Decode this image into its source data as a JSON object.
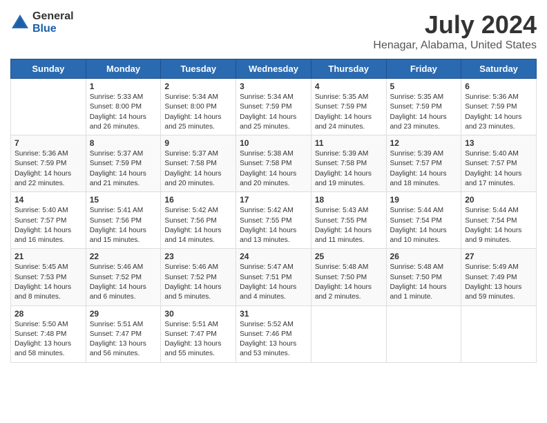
{
  "logo": {
    "general": "General",
    "blue": "Blue"
  },
  "title": "July 2024",
  "location": "Henagar, Alabama, United States",
  "headers": [
    "Sunday",
    "Monday",
    "Tuesday",
    "Wednesday",
    "Thursday",
    "Friday",
    "Saturday"
  ],
  "weeks": [
    [
      {
        "day": "",
        "sunrise": "",
        "sunset": "",
        "daylight": ""
      },
      {
        "day": "1",
        "sunrise": "Sunrise: 5:33 AM",
        "sunset": "Sunset: 8:00 PM",
        "daylight": "Daylight: 14 hours and 26 minutes."
      },
      {
        "day": "2",
        "sunrise": "Sunrise: 5:34 AM",
        "sunset": "Sunset: 8:00 PM",
        "daylight": "Daylight: 14 hours and 25 minutes."
      },
      {
        "day": "3",
        "sunrise": "Sunrise: 5:34 AM",
        "sunset": "Sunset: 7:59 PM",
        "daylight": "Daylight: 14 hours and 25 minutes."
      },
      {
        "day": "4",
        "sunrise": "Sunrise: 5:35 AM",
        "sunset": "Sunset: 7:59 PM",
        "daylight": "Daylight: 14 hours and 24 minutes."
      },
      {
        "day": "5",
        "sunrise": "Sunrise: 5:35 AM",
        "sunset": "Sunset: 7:59 PM",
        "daylight": "Daylight: 14 hours and 23 minutes."
      },
      {
        "day": "6",
        "sunrise": "Sunrise: 5:36 AM",
        "sunset": "Sunset: 7:59 PM",
        "daylight": "Daylight: 14 hours and 23 minutes."
      }
    ],
    [
      {
        "day": "7",
        "sunrise": "Sunrise: 5:36 AM",
        "sunset": "Sunset: 7:59 PM",
        "daylight": "Daylight: 14 hours and 22 minutes."
      },
      {
        "day": "8",
        "sunrise": "Sunrise: 5:37 AM",
        "sunset": "Sunset: 7:59 PM",
        "daylight": "Daylight: 14 hours and 21 minutes."
      },
      {
        "day": "9",
        "sunrise": "Sunrise: 5:37 AM",
        "sunset": "Sunset: 7:58 PM",
        "daylight": "Daylight: 14 hours and 20 minutes."
      },
      {
        "day": "10",
        "sunrise": "Sunrise: 5:38 AM",
        "sunset": "Sunset: 7:58 PM",
        "daylight": "Daylight: 14 hours and 20 minutes."
      },
      {
        "day": "11",
        "sunrise": "Sunrise: 5:39 AM",
        "sunset": "Sunset: 7:58 PM",
        "daylight": "Daylight: 14 hours and 19 minutes."
      },
      {
        "day": "12",
        "sunrise": "Sunrise: 5:39 AM",
        "sunset": "Sunset: 7:57 PM",
        "daylight": "Daylight: 14 hours and 18 minutes."
      },
      {
        "day": "13",
        "sunrise": "Sunrise: 5:40 AM",
        "sunset": "Sunset: 7:57 PM",
        "daylight": "Daylight: 14 hours and 17 minutes."
      }
    ],
    [
      {
        "day": "14",
        "sunrise": "Sunrise: 5:40 AM",
        "sunset": "Sunset: 7:57 PM",
        "daylight": "Daylight: 14 hours and 16 minutes."
      },
      {
        "day": "15",
        "sunrise": "Sunrise: 5:41 AM",
        "sunset": "Sunset: 7:56 PM",
        "daylight": "Daylight: 14 hours and 15 minutes."
      },
      {
        "day": "16",
        "sunrise": "Sunrise: 5:42 AM",
        "sunset": "Sunset: 7:56 PM",
        "daylight": "Daylight: 14 hours and 14 minutes."
      },
      {
        "day": "17",
        "sunrise": "Sunrise: 5:42 AM",
        "sunset": "Sunset: 7:55 PM",
        "daylight": "Daylight: 14 hours and 13 minutes."
      },
      {
        "day": "18",
        "sunrise": "Sunrise: 5:43 AM",
        "sunset": "Sunset: 7:55 PM",
        "daylight": "Daylight: 14 hours and 11 minutes."
      },
      {
        "day": "19",
        "sunrise": "Sunrise: 5:44 AM",
        "sunset": "Sunset: 7:54 PM",
        "daylight": "Daylight: 14 hours and 10 minutes."
      },
      {
        "day": "20",
        "sunrise": "Sunrise: 5:44 AM",
        "sunset": "Sunset: 7:54 PM",
        "daylight": "Daylight: 14 hours and 9 minutes."
      }
    ],
    [
      {
        "day": "21",
        "sunrise": "Sunrise: 5:45 AM",
        "sunset": "Sunset: 7:53 PM",
        "daylight": "Daylight: 14 hours and 8 minutes."
      },
      {
        "day": "22",
        "sunrise": "Sunrise: 5:46 AM",
        "sunset": "Sunset: 7:52 PM",
        "daylight": "Daylight: 14 hours and 6 minutes."
      },
      {
        "day": "23",
        "sunrise": "Sunrise: 5:46 AM",
        "sunset": "Sunset: 7:52 PM",
        "daylight": "Daylight: 14 hours and 5 minutes."
      },
      {
        "day": "24",
        "sunrise": "Sunrise: 5:47 AM",
        "sunset": "Sunset: 7:51 PM",
        "daylight": "Daylight: 14 hours and 4 minutes."
      },
      {
        "day": "25",
        "sunrise": "Sunrise: 5:48 AM",
        "sunset": "Sunset: 7:50 PM",
        "daylight": "Daylight: 14 hours and 2 minutes."
      },
      {
        "day": "26",
        "sunrise": "Sunrise: 5:48 AM",
        "sunset": "Sunset: 7:50 PM",
        "daylight": "Daylight: 14 hours and 1 minute."
      },
      {
        "day": "27",
        "sunrise": "Sunrise: 5:49 AM",
        "sunset": "Sunset: 7:49 PM",
        "daylight": "Daylight: 13 hours and 59 minutes."
      }
    ],
    [
      {
        "day": "28",
        "sunrise": "Sunrise: 5:50 AM",
        "sunset": "Sunset: 7:48 PM",
        "daylight": "Daylight: 13 hours and 58 minutes."
      },
      {
        "day": "29",
        "sunrise": "Sunrise: 5:51 AM",
        "sunset": "Sunset: 7:47 PM",
        "daylight": "Daylight: 13 hours and 56 minutes."
      },
      {
        "day": "30",
        "sunrise": "Sunrise: 5:51 AM",
        "sunset": "Sunset: 7:47 PM",
        "daylight": "Daylight: 13 hours and 55 minutes."
      },
      {
        "day": "31",
        "sunrise": "Sunrise: 5:52 AM",
        "sunset": "Sunset: 7:46 PM",
        "daylight": "Daylight: 13 hours and 53 minutes."
      },
      {
        "day": "",
        "sunrise": "",
        "sunset": "",
        "daylight": ""
      },
      {
        "day": "",
        "sunrise": "",
        "sunset": "",
        "daylight": ""
      },
      {
        "day": "",
        "sunrise": "",
        "sunset": "",
        "daylight": ""
      }
    ]
  ]
}
